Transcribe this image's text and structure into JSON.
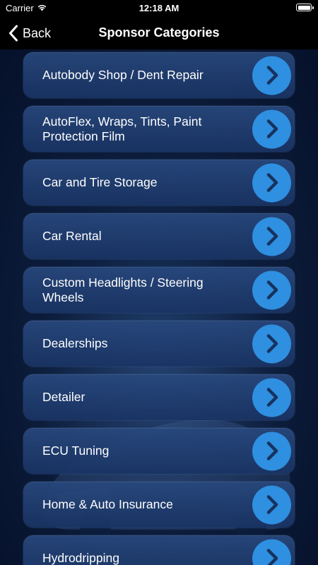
{
  "status_bar": {
    "carrier": "Carrier",
    "time": "12:18 AM"
  },
  "nav": {
    "back_label": "Back",
    "title": "Sponsor Categories"
  },
  "categories": [
    {
      "label": "Autobody Shop / Dent Repair"
    },
    {
      "label": "AutoFlex, Wraps, Tints, Paint Protection Film"
    },
    {
      "label": "Car and Tire Storage"
    },
    {
      "label": "Car Rental"
    },
    {
      "label": "Custom Headlights / Steering Wheels"
    },
    {
      "label": "Dealerships"
    },
    {
      "label": "Detailer"
    },
    {
      "label": "ECU Tuning"
    },
    {
      "label": "Home & Auto Insurance"
    },
    {
      "label": "Hydrodripping"
    }
  ],
  "icons": {
    "wifi": "wifi-icon",
    "battery": "battery-icon",
    "back": "chevron-left-icon",
    "row_action": "chevron-right-icon"
  },
  "colors": {
    "accent": "#2f8fe0",
    "chevron": "#16335f",
    "row_bg": "#21427a",
    "background": "#0c1d3c"
  }
}
